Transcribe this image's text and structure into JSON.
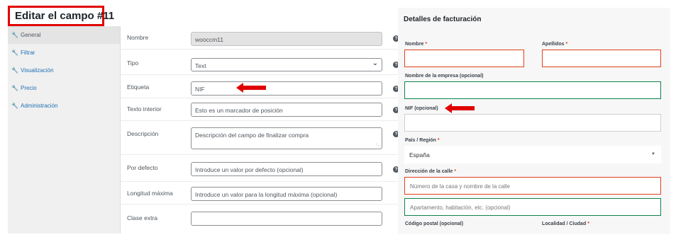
{
  "editor": {
    "title": "Editar el campo #11",
    "tabs": [
      {
        "label": "General",
        "active": true
      },
      {
        "label": "Filtrar"
      },
      {
        "label": "Visualización"
      },
      {
        "label": "Precio"
      },
      {
        "label": "Administración"
      }
    ],
    "fields": {
      "nombre": {
        "label": "Nombre",
        "value": "wooccm11"
      },
      "tipo": {
        "label": "Tipo",
        "value": "Text"
      },
      "etiqueta": {
        "label": "Etiqueta",
        "value": "NIF"
      },
      "texto_interior": {
        "label": "Texto interior",
        "value": "Esto es un marcador de posición"
      },
      "descripcion": {
        "label": "Descripción",
        "value": "Descripción del campo de finalizar compra"
      },
      "por_defecto": {
        "label": "Por defecto",
        "placeholder": "Introduce un valor por defecto (opcional)"
      },
      "longitud_maxima": {
        "label": "Longitud máxima",
        "placeholder": "Introduce un valor para la longitud máxima (opcional)"
      },
      "clase_extra": {
        "label": "Clase extra",
        "value": ""
      }
    },
    "help_glyph": "?"
  },
  "checkout": {
    "title": "Detalles de facturación",
    "required_mark": "*",
    "nombre_label": "Nombre",
    "apellidos_label": "Apellidos",
    "empresa_label": "Nombre de la empresa (opcional)",
    "nif_label": "NIF (opcional)",
    "pais_label": "País / Región",
    "pais_value": "España",
    "direccion_label": "Dirección de la calle",
    "direccion_placeholder": "Número de la casa y nombre de la calle",
    "direccion2_placeholder": "Apartamento, habitación, etc. (opcional)",
    "codigo_postal_label": "Código postal (opcional)",
    "localidad_label": "Localidad / Ciudad"
  },
  "colors": {
    "highlight_red": "#e00000",
    "error_border": "#e2401c",
    "valid_border": "#0f834d"
  },
  "icons": {
    "tab": "wrench-icon",
    "help": "help-icon",
    "select": "chevron-down-icon",
    "annotation": "red-arrow-icon"
  }
}
